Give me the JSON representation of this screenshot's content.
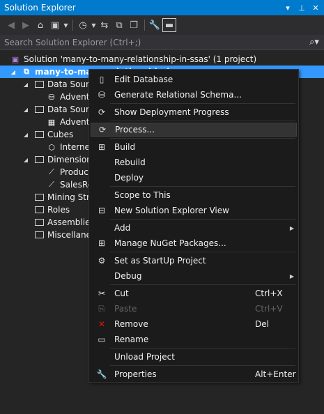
{
  "window": {
    "title": "Solution Explorer",
    "controls": [
      "▾",
      "⊥",
      "✕"
    ]
  },
  "toolbar": {
    "buttons": [
      {
        "name": "back-icon",
        "glyph": "◀"
      },
      {
        "name": "forward-icon",
        "glyph": "▶"
      },
      {
        "name": "home-icon",
        "glyph": "⌂"
      },
      {
        "name": "switch-views-icon",
        "glyph": "▣"
      },
      {
        "name": "pending-changes-icon",
        "glyph": "◷"
      },
      {
        "name": "sync-icon",
        "glyph": "⇆"
      },
      {
        "name": "collapse-all-icon",
        "glyph": "⧉"
      },
      {
        "name": "show-all-files-icon",
        "glyph": "❐"
      },
      {
        "name": "properties-icon",
        "glyph": "🔧"
      },
      {
        "name": "preview-icon",
        "glyph": "▬"
      }
    ]
  },
  "search": {
    "placeholder": "Search Solution Explorer (Ctrl+;)"
  },
  "tree": {
    "solution": "Solution 'many-to-many-relationship-in-ssas' (1 project)",
    "project": "many-to-many-relationship-in-ssas",
    "nodes": [
      {
        "label": "Data Sources",
        "level": 2
      },
      {
        "label": "Adventure Works DW",
        "level": 3
      },
      {
        "label": "Data Source Views",
        "level": 2
      },
      {
        "label": "Adventure Works DW",
        "level": 3
      },
      {
        "label": "Cubes",
        "level": 2
      },
      {
        "label": "Internet Sales",
        "level": 3
      },
      {
        "label": "Dimensions",
        "level": 2
      },
      {
        "label": "Product",
        "level": 3
      },
      {
        "label": "SalesReason",
        "level": 3
      },
      {
        "label": "Mining Structures",
        "level": 2
      },
      {
        "label": "Roles",
        "level": 2
      },
      {
        "label": "Assemblies",
        "level": 2
      },
      {
        "label": "Miscellaneous",
        "level": 2
      }
    ]
  },
  "context_menu": {
    "items": [
      {
        "label": "Edit Database",
        "shortcut": "",
        "icon": "edit-database-icon",
        "glyph": "▯"
      },
      {
        "label": "Generate Relational Schema...",
        "shortcut": "",
        "icon": "generate-schema-icon",
        "glyph": "⛁"
      },
      {
        "label": "Show Deployment Progress",
        "shortcut": "",
        "icon": "deployment-progress-icon",
        "glyph": "⟳"
      },
      {
        "label": "Process...",
        "shortcut": "",
        "icon": "process-icon",
        "glyph": "⟳"
      },
      {
        "label": "Build",
        "shortcut": "",
        "icon": "build-icon",
        "glyph": "⊞"
      },
      {
        "label": "Rebuild",
        "shortcut": "",
        "icon": "",
        "glyph": ""
      },
      {
        "label": "Deploy",
        "shortcut": "",
        "icon": "",
        "glyph": ""
      },
      {
        "label": "Scope to This",
        "shortcut": "",
        "icon": "",
        "glyph": ""
      },
      {
        "label": "New Solution Explorer View",
        "shortcut": "",
        "icon": "new-view-icon",
        "glyph": "⊟"
      },
      {
        "label": "Add",
        "shortcut": "",
        "icon": "",
        "glyph": ""
      },
      {
        "label": "Manage NuGet Packages...",
        "shortcut": "",
        "icon": "nuget-icon",
        "glyph": "⊞"
      },
      {
        "label": "Set as StartUp Project",
        "shortcut": "",
        "icon": "gear-icon",
        "glyph": "⚙"
      },
      {
        "label": "Debug",
        "shortcut": "",
        "icon": "",
        "glyph": ""
      },
      {
        "label": "Cut",
        "shortcut": "Ctrl+X",
        "icon": "cut-icon",
        "glyph": "✂"
      },
      {
        "label": "Paste",
        "shortcut": "Ctrl+V",
        "icon": "paste-icon",
        "glyph": "⎘"
      },
      {
        "label": "Remove",
        "shortcut": "Del",
        "icon": "remove-icon",
        "glyph": "✕"
      },
      {
        "label": "Rename",
        "shortcut": "",
        "icon": "rename-icon",
        "glyph": "▭"
      },
      {
        "label": "Unload Project",
        "shortcut": "",
        "icon": "",
        "glyph": ""
      },
      {
        "label": "Properties",
        "shortcut": "Alt+Enter",
        "icon": "wrench-icon",
        "glyph": "🔧"
      }
    ]
  },
  "colors": {
    "accent": "#007acc",
    "selection": "#3399ff",
    "remove_icon": "#e51400"
  }
}
